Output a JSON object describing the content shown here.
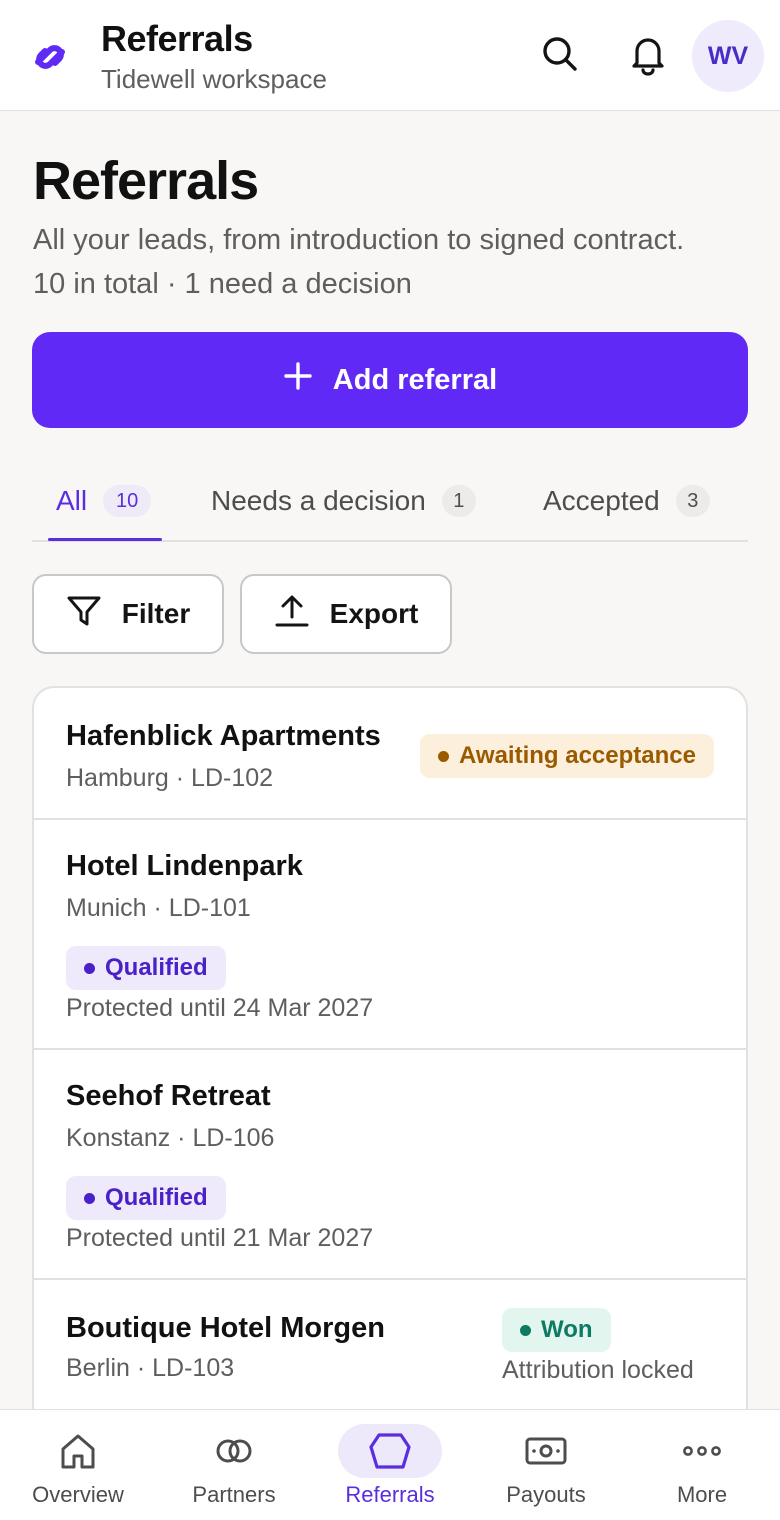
{
  "app": {
    "title": "Referrals",
    "workspace": "Tidewell workspace",
    "avatar_initials": "WV",
    "accent_color": "#6129f5"
  },
  "page": {
    "title": "Referrals",
    "description": "All your leads, from introduction to signed contract.",
    "meta": "10 in total · 1 need a decision",
    "add_button_label": "Add referral"
  },
  "tabs": [
    {
      "label": "All",
      "count": "10",
      "active": true
    },
    {
      "label": "Needs a decision",
      "count": "1",
      "active": false
    },
    {
      "label": "Accepted",
      "count": "3",
      "active": false
    }
  ],
  "actions": {
    "filter_label": "Filter",
    "export_label": "Export"
  },
  "referrals": [
    {
      "name": "Hafenblick Apartments",
      "location": "Hamburg · LD-102",
      "status": "Awaiting acceptance",
      "status_color": "#9a5a00",
      "note": ""
    },
    {
      "name": "Hotel Lindenpark",
      "location": "Munich · LD-101",
      "status": "Qualified",
      "status_color": "#4a20c8",
      "note": "Protected until 24 Mar 2027"
    },
    {
      "name": "Seehof Retreat",
      "location": "Konstanz · LD-106",
      "status": "Qualified",
      "status_color": "#4a20c8",
      "note": "Protected until 21 Mar 2027"
    },
    {
      "name": "Boutique Hotel Morgen",
      "location": "Berlin · LD-103",
      "status": "Won",
      "status_color": "#0d7a63",
      "note": "Attribution locked"
    }
  ],
  "nav": [
    {
      "label": "Overview",
      "icon": "home-icon",
      "active": false
    },
    {
      "label": "Partners",
      "icon": "partners-icon",
      "active": false
    },
    {
      "label": "Referrals",
      "icon": "referrals-icon",
      "active": true
    },
    {
      "label": "Payouts",
      "icon": "payouts-icon",
      "active": false
    },
    {
      "label": "More",
      "icon": "more-icon",
      "active": false
    }
  ]
}
